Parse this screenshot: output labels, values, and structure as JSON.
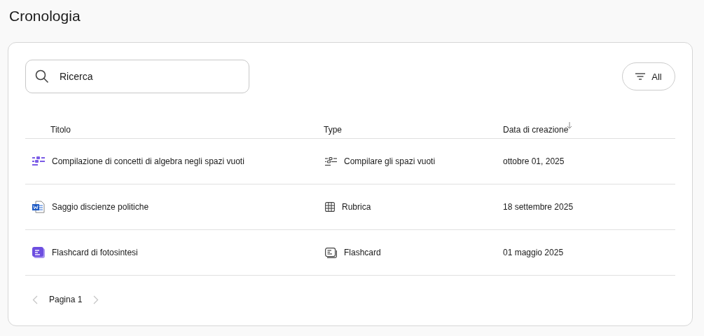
{
  "page_title": "Cronologia",
  "search": {
    "value": "Ricerca"
  },
  "filter": {
    "label": "All"
  },
  "table": {
    "columns": [
      {
        "label": "Titolo",
        "sorted": false
      },
      {
        "label": "Type",
        "sorted": false
      },
      {
        "label": "Data di creazione",
        "sorted": true
      }
    ],
    "rows": [
      {
        "title": "Compilazione di concetti di algebra negli spazi vuoti",
        "kind": "fill-blanks",
        "type": {
          "label": "Compilare gli spazi vuoti",
          "kind": "fill-blanks"
        },
        "date": "ottobre 01, 2025"
      },
      {
        "title": "Saggio discienze politiche",
        "kind": "document",
        "type": {
          "label": "Rubrica",
          "kind": "grid"
        },
        "date": "18 settembre 2025"
      },
      {
        "title": "Flashcard di fotosintesi",
        "kind": "flashcard",
        "type": {
          "label": "Flashcard",
          "kind": "flashcard"
        },
        "date": "01 maggio 2025"
      }
    ]
  },
  "pagination": {
    "label": "Pagina 1",
    "prev_disabled": true,
    "next_disabled": true
  }
}
